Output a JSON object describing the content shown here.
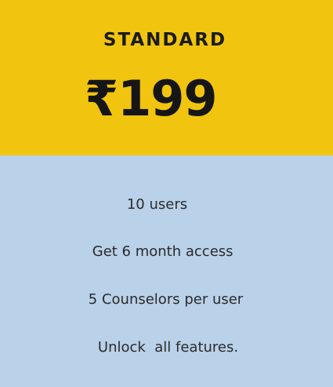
{
  "plan": {
    "name": "STANDARD",
    "price": "₹199"
  },
  "features": [
    "10 users",
    "Get 6 month access ",
    "5 Counselors per user",
    "Unlock  all features."
  ],
  "colors": {
    "header_background": "#f1c40f",
    "body_background": "#b9d1e9",
    "price_text": "#161616",
    "feature_text": "#2b2b2b"
  }
}
